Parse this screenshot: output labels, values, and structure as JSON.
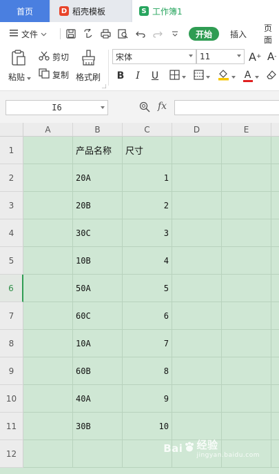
{
  "tabs": {
    "home": "首页",
    "daoke": "稻壳模板",
    "daoke_logo": "D",
    "workbook": "工作簿1",
    "workbook_logo": "S"
  },
  "menu": {
    "file": "文件",
    "start": "开始",
    "insert": "插入",
    "page": "页面"
  },
  "ribbon": {
    "paste": "粘贴",
    "cut": "剪切",
    "copy": "复制",
    "format_painter": "格式刷",
    "font_name": "宋体",
    "font_size": "11",
    "grow_font": "A",
    "shrink_font": "A",
    "bold": "B",
    "italic": "I",
    "underline": "U",
    "font_color": "A",
    "colors": {
      "accent": "#2f9c53",
      "fill_yellow": "#f6c500",
      "font_red": "#e02020",
      "tab_blue": "#4a7fe0"
    }
  },
  "formula_bar": {
    "name_box": "I6",
    "fx": "fx"
  },
  "sheet": {
    "columns": [
      "A",
      "B",
      "C",
      "D",
      "E"
    ],
    "rows": [
      "1",
      "2",
      "3",
      "4",
      "5",
      "6",
      "7",
      "8",
      "9",
      "10",
      "11",
      "12"
    ],
    "active_row": "6",
    "header_b": "产品名称",
    "header_c": "尺寸",
    "data": [
      {
        "b": "20A",
        "c": "1"
      },
      {
        "b": "20B",
        "c": "2"
      },
      {
        "b": "30C",
        "c": "3"
      },
      {
        "b": "10B",
        "c": "4"
      },
      {
        "b": "50A",
        "c": "5"
      },
      {
        "b": "60C",
        "c": "6"
      },
      {
        "b": "10A",
        "c": "7"
      },
      {
        "b": "60B",
        "c": "8"
      },
      {
        "b": "40A",
        "c": "9"
      },
      {
        "b": "30B",
        "c": "10"
      }
    ],
    "background": "#cfe7d4"
  },
  "watermark": {
    "brand": "Bai",
    "brand2": "经验",
    "sub": "jingyan.baidu.com"
  }
}
